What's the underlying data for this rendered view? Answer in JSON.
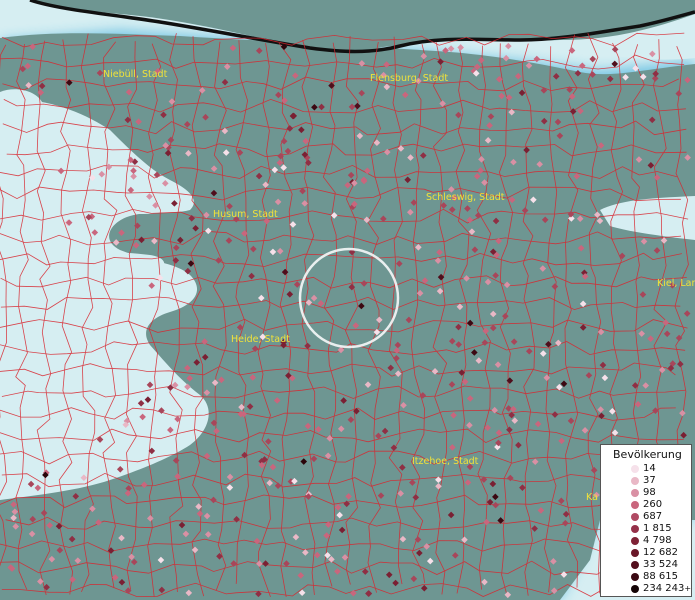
{
  "map": {
    "water_color": "#d6eef2",
    "land_color": "#6e9692",
    "boundary_color": "#d8262f",
    "coast_shadow_color": "#2aa6d8",
    "dot_colors": [
      "#f6e1ea",
      "#e9b8c6",
      "#d990a4",
      "#c9667d",
      "#a8465a",
      "#8f2f44",
      "#7a2033",
      "#641626",
      "#4f0e1c",
      "#3c0812",
      "#2a0409",
      "#120204"
    ],
    "places": [
      {
        "id": "niebuell",
        "name": "Niebüll, Stadt"
      },
      {
        "id": "flensburg",
        "name": "Flensburg, Stadt"
      },
      {
        "id": "schleswig",
        "name": "Schleswig, Stadt"
      },
      {
        "id": "husum",
        "name": "Husum, Stadt"
      },
      {
        "id": "kiel",
        "name": "Kiel, Lan"
      },
      {
        "id": "heide",
        "name": "Heide, Stadt"
      },
      {
        "id": "itzehoe",
        "name": "Itzehoe, Stadt"
      },
      {
        "id": "ka",
        "name": "Ka"
      }
    ],
    "highlight_circle": true
  },
  "legend": {
    "title": "Bevölkerung",
    "entries": [
      {
        "label": "14",
        "color": "#f6e1ea"
      },
      {
        "label": "37",
        "color": "#e9b8c6"
      },
      {
        "label": "98",
        "color": "#d990a4"
      },
      {
        "label": "260",
        "color": "#c9667d"
      },
      {
        "label": "687",
        "color": "#b04a63"
      },
      {
        "label": "1 815",
        "color": "#953049"
      },
      {
        "label": "4 798",
        "color": "#7f2236"
      },
      {
        "label": "12 682",
        "color": "#6a1728"
      },
      {
        "label": "33 524",
        "color": "#540e1d"
      },
      {
        "label": "88 615",
        "color": "#3a0812"
      },
      {
        "label": "234 243",
        "color": "#140305",
        "plus": "+"
      }
    ]
  }
}
